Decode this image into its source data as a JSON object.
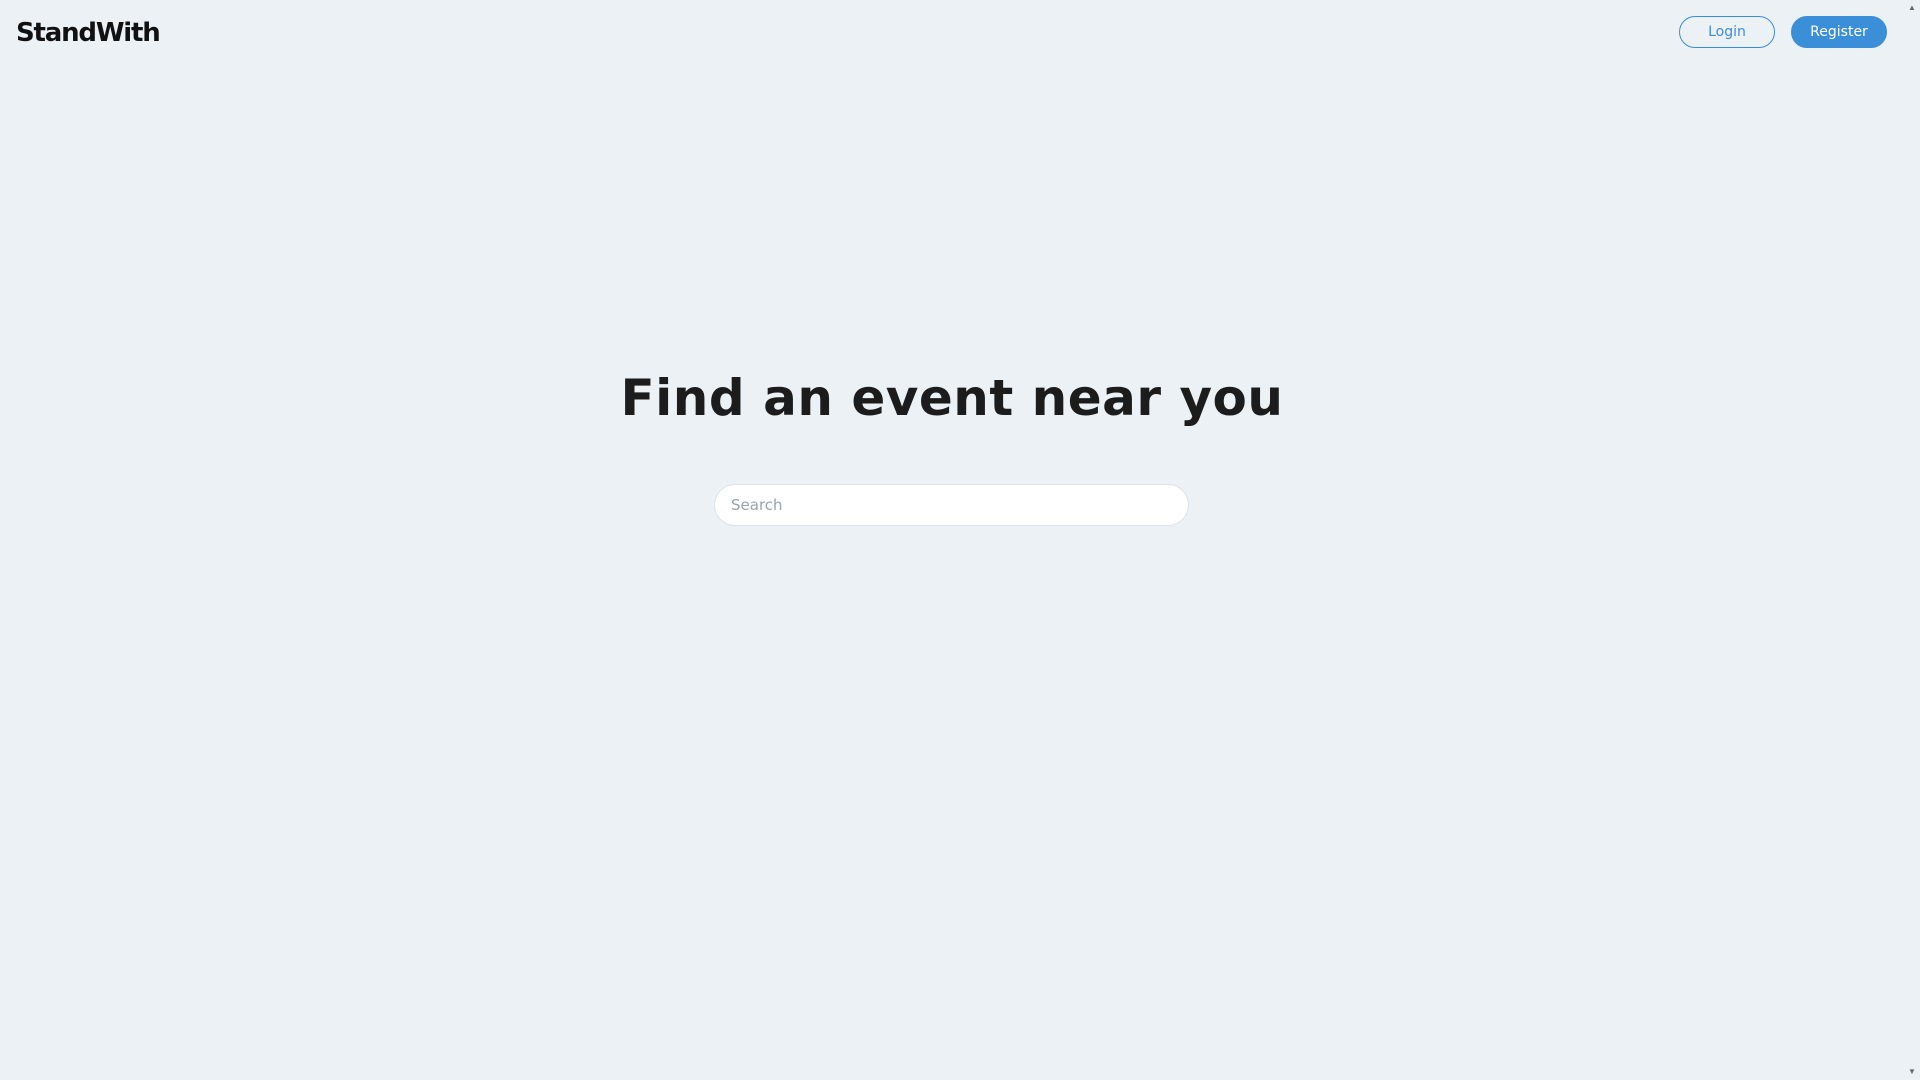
{
  "header": {
    "logo_text": "StandWith",
    "login_label": "Login",
    "register_label": "Register"
  },
  "main": {
    "title": "Find an event near you",
    "search": {
      "placeholder": "Search",
      "value": ""
    }
  },
  "scrollbar": {
    "up_arrow": "▲",
    "down_arrow": "▼"
  },
  "colors": {
    "background": "#ecf1f5",
    "accent": "#3b8ed8",
    "title_text": "#1c1c1c"
  }
}
